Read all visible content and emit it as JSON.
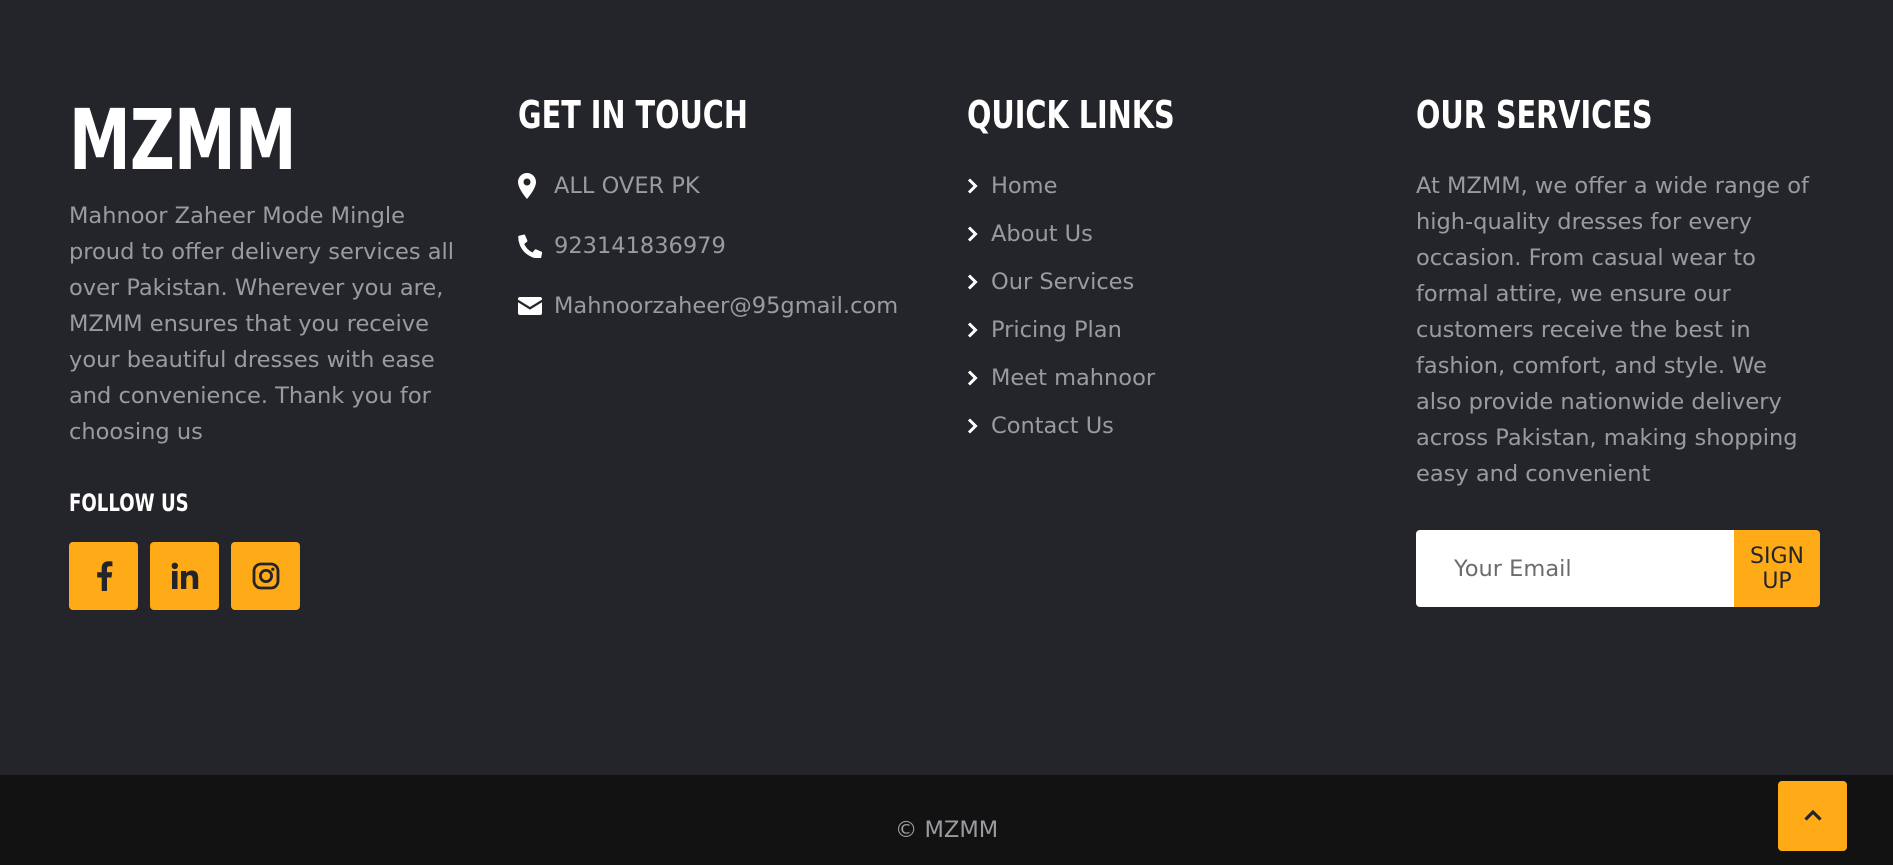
{
  "brand": {
    "name": "MZMM",
    "description": "Mahnoor Zaheer Mode Mingle proud to offer delivery services all over Pakistan. Wherever you are, MZMM ensures that you receive your beautiful dresses with ease and convenience. Thank you for choosing us"
  },
  "follow": {
    "title": "FOLLOW US",
    "icons": [
      "facebook-icon",
      "linkedin-icon",
      "instagram-icon"
    ]
  },
  "contact": {
    "title": "GET IN TOUCH",
    "items": [
      {
        "icon": "map-pin-icon",
        "text": "ALL OVER PK"
      },
      {
        "icon": "phone-icon",
        "text": "923141836979"
      },
      {
        "icon": "envelope-icon",
        "text": "Mahnoorzaheer@95gmail.com"
      }
    ]
  },
  "quick_links": {
    "title": "QUICK LINKS",
    "items": [
      "Home",
      "About Us",
      "Our Services",
      "Pricing Plan",
      "Meet mahnoor",
      "Contact Us"
    ]
  },
  "services": {
    "title": "OUR SERVICES",
    "description": "At MZMM, we offer a wide range of high-quality dresses for every occasion. From casual wear to formal attire, we ensure our customers receive the best in fashion, comfort, and style. We also provide nationwide delivery across Pakistan, making shopping easy and convenient"
  },
  "newsletter": {
    "email_placeholder": "Your Email",
    "email_value": "",
    "button_label": "SIGN UP"
  },
  "bottom": {
    "copyright": "© MZMM"
  },
  "colors": {
    "accent": "#ffaa17",
    "background": "#24252a",
    "bottom_bar": "#121213",
    "text_muted": "#9a9ba0"
  }
}
